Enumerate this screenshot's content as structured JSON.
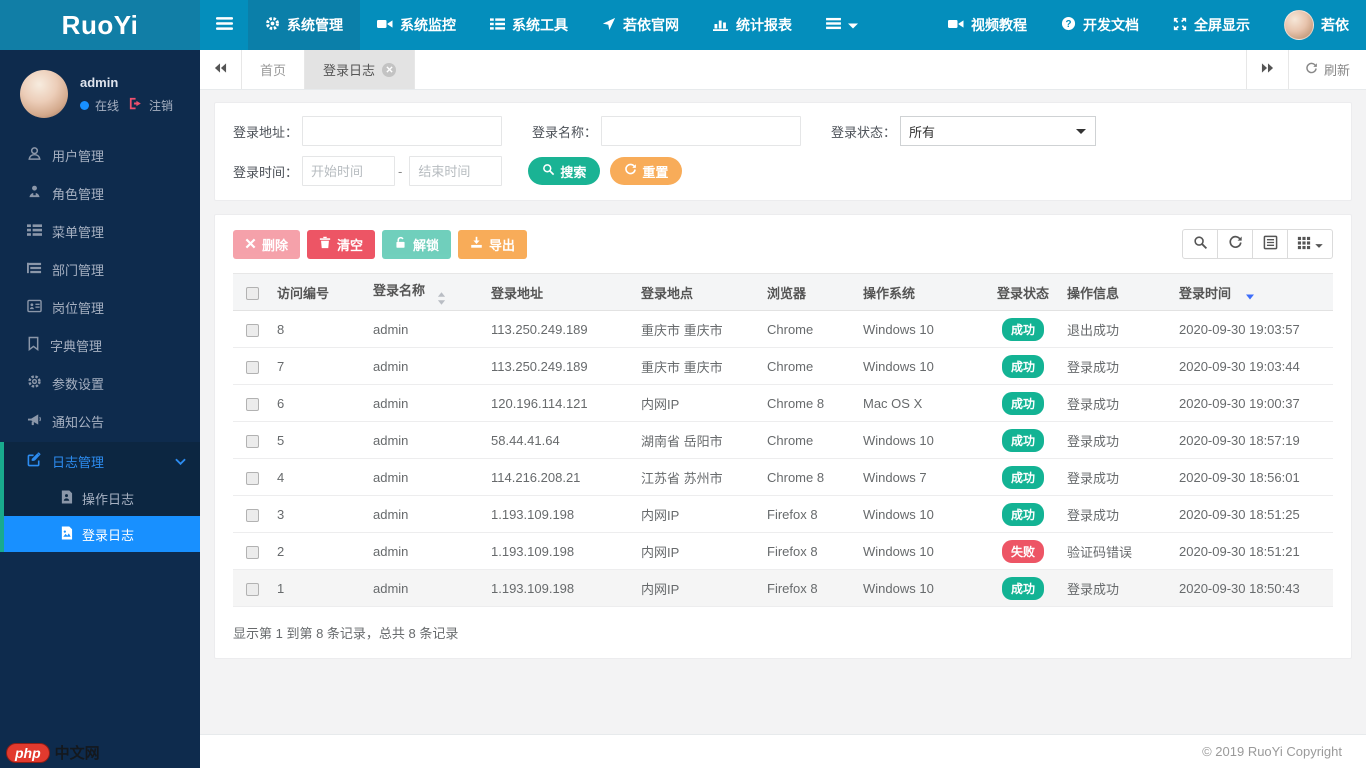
{
  "colors": {
    "navbar": "#048ebc",
    "navbar_active": "#0b7fa9",
    "logo_bg": "#117ea6",
    "sidebar": "#0e2b4d",
    "active_item": "#1890ff",
    "group_stripe": "#19aa8d",
    "primary": "#1ab394",
    "warning": "#f8ac59",
    "danger": "#ed5565",
    "success_badge": "#13b394"
  },
  "navbar": {
    "logo": "RuoYi",
    "menu": [
      {
        "label": "系统管理",
        "icon": "gear-icon",
        "active": true
      },
      {
        "label": "系统监控",
        "icon": "monitor-icon"
      },
      {
        "label": "系统工具",
        "icon": "tools-icon"
      },
      {
        "label": "若依官网",
        "icon": "location-arrow-icon"
      },
      {
        "label": "统计报表",
        "icon": "bar-chart-icon"
      }
    ],
    "right": [
      {
        "label": "视频教程",
        "icon": "video-icon"
      },
      {
        "label": "开发文档",
        "icon": "question-icon"
      },
      {
        "label": "全屏显示",
        "icon": "fullscreen-icon"
      },
      {
        "label": "若依",
        "icon": "avatar"
      }
    ]
  },
  "sidebar": {
    "user": {
      "name": "admin",
      "status": "在线",
      "logout": "注销"
    },
    "items": [
      {
        "label": "用户管理",
        "icon": "user-icon"
      },
      {
        "label": "角色管理",
        "icon": "role-icon"
      },
      {
        "label": "菜单管理",
        "icon": "menu-list-icon"
      },
      {
        "label": "部门管理",
        "icon": "dept-icon"
      },
      {
        "label": "岗位管理",
        "icon": "post-icon"
      },
      {
        "label": "字典管理",
        "icon": "dict-icon"
      },
      {
        "label": "参数设置",
        "icon": "settings-icon"
      },
      {
        "label": "通知公告",
        "icon": "notice-icon"
      }
    ],
    "group": {
      "label": "日志管理",
      "icon": "log-icon",
      "expanded": true,
      "children": [
        {
          "label": "操作日志",
          "icon": "operation-log-icon"
        },
        {
          "label": "登录日志",
          "icon": "login-log-icon",
          "active": true
        }
      ]
    },
    "watermark": {
      "badge": "php",
      "text": "中文网"
    }
  },
  "tabbar": {
    "tabs": [
      {
        "label": "首页"
      },
      {
        "label": "登录日志",
        "active": true,
        "closable": true
      }
    ],
    "refresh": "刷新"
  },
  "search": {
    "address_label": "登录地址：",
    "name_label": "登录名称：",
    "status_label": "登录状态：",
    "status_value": "所有",
    "time_label": "登录时间：",
    "time_start_placeholder": "开始时间",
    "time_separator": "-",
    "time_end_placeholder": "结束时间",
    "search_button": "搜索",
    "reset_button": "重置"
  },
  "toolbar": {
    "delete_label": "删除",
    "clear_label": "清空",
    "unlock_label": "解锁",
    "export_label": "导出"
  },
  "table": {
    "columns": [
      "访问编号",
      "登录名称",
      "登录地址",
      "登录地点",
      "浏览器",
      "操作系统",
      "登录状态",
      "操作信息",
      "登录时间"
    ],
    "rows": [
      {
        "id": "8",
        "name": "admin",
        "ip": "113.250.249.189",
        "location": "重庆市 重庆市",
        "browser": "Chrome",
        "os": "Windows 10",
        "status": "成功",
        "status_type": "success",
        "message": "退出成功",
        "time": "2020-09-30 19:03:57"
      },
      {
        "id": "7",
        "name": "admin",
        "ip": "113.250.249.189",
        "location": "重庆市 重庆市",
        "browser": "Chrome",
        "os": "Windows 10",
        "status": "成功",
        "status_type": "success",
        "message": "登录成功",
        "time": "2020-09-30 19:03:44"
      },
      {
        "id": "6",
        "name": "admin",
        "ip": "120.196.114.121",
        "location": "内网IP",
        "browser": "Chrome 8",
        "os": "Mac OS X",
        "status": "成功",
        "status_type": "success",
        "message": "登录成功",
        "time": "2020-09-30 19:00:37"
      },
      {
        "id": "5",
        "name": "admin",
        "ip": "58.44.41.64",
        "location": "湖南省 岳阳市",
        "browser": "Chrome",
        "os": "Windows 10",
        "status": "成功",
        "status_type": "success",
        "message": "登录成功",
        "time": "2020-09-30 18:57:19"
      },
      {
        "id": "4",
        "name": "admin",
        "ip": "114.216.208.21",
        "location": "江苏省 苏州市",
        "browser": "Chrome 8",
        "os": "Windows 7",
        "status": "成功",
        "status_type": "success",
        "message": "登录成功",
        "time": "2020-09-30 18:56:01"
      },
      {
        "id": "3",
        "name": "admin",
        "ip": "1.193.109.198",
        "location": "内网IP",
        "browser": "Firefox 8",
        "os": "Windows 10",
        "status": "成功",
        "status_type": "success",
        "message": "登录成功",
        "time": "2020-09-30 18:51:25"
      },
      {
        "id": "2",
        "name": "admin",
        "ip": "1.193.109.198",
        "location": "内网IP",
        "browser": "Firefox 8",
        "os": "Windows 10",
        "status": "失败",
        "status_type": "fail",
        "message": "验证码错误",
        "time": "2020-09-30 18:51:21"
      },
      {
        "id": "1",
        "name": "admin",
        "ip": "1.193.109.198",
        "location": "内网IP",
        "browser": "Firefox 8",
        "os": "Windows 10",
        "status": "成功",
        "status_type": "success",
        "message": "登录成功",
        "time": "2020-09-30 18:50:43",
        "highlighted": true
      }
    ],
    "summary": "显示第 1 到第 8 条记录，总共 8 条记录"
  },
  "footer": {
    "copyright": "© 2019 RuoYi Copyright"
  }
}
